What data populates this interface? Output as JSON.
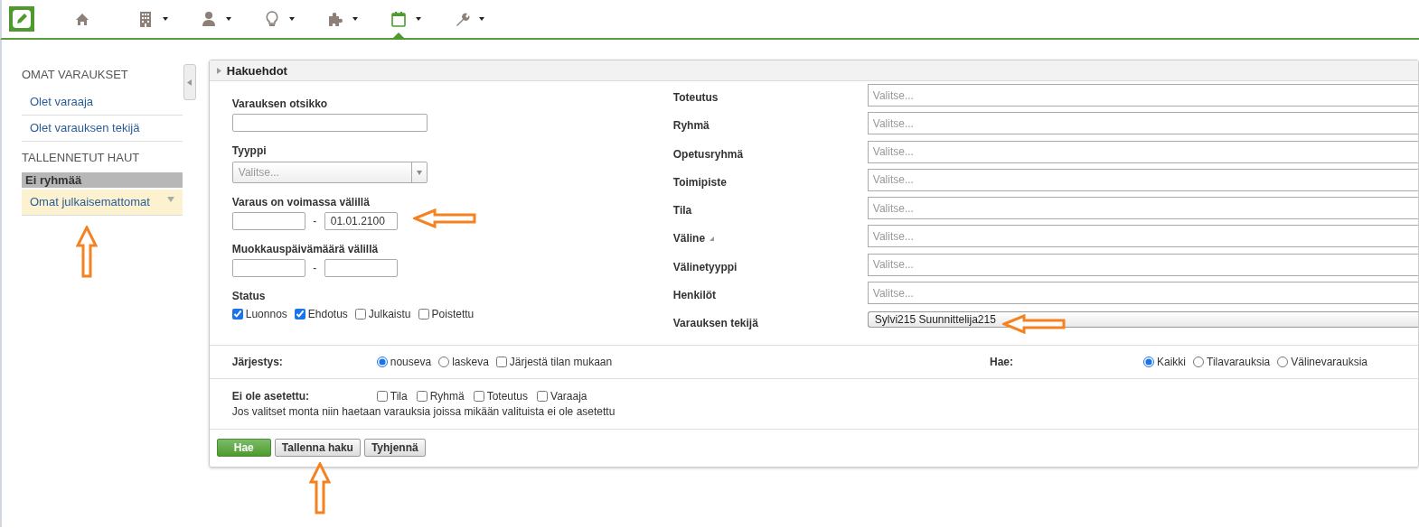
{
  "nav": {
    "items": [
      {
        "kind": "home",
        "dropdown": false,
        "selected": false
      },
      {
        "kind": "building",
        "dropdown": true,
        "selected": false
      },
      {
        "kind": "person",
        "dropdown": true,
        "selected": false
      },
      {
        "kind": "bulb",
        "dropdown": true,
        "selected": false
      },
      {
        "kind": "puzzle",
        "dropdown": true,
        "selected": false
      },
      {
        "kind": "calendar",
        "dropdown": true,
        "selected": true
      },
      {
        "kind": "wrench",
        "dropdown": true,
        "selected": false
      }
    ]
  },
  "sidebar": {
    "sections": [
      {
        "heading": "OMAT VARAUKSET",
        "items": [
          {
            "label": "Olet varaaja",
            "selected": false
          },
          {
            "label": "Olet varauksen tekijä",
            "selected": false
          }
        ]
      },
      {
        "heading": "TALLENNETUT HAUT",
        "group": "Ei ryhmää",
        "items": [
          {
            "label": "Omat julkaisemattomat",
            "selected": true
          }
        ]
      }
    ]
  },
  "panel": {
    "title": "Hakuehdot",
    "title_field": {
      "label": "Varauksen otsikko"
    },
    "type_field": {
      "label": "Tyyppi",
      "placeholder": "Valitse..."
    },
    "valid_range": {
      "label": "Varaus on voimassa välillä",
      "separator": "-",
      "to": "01.01.2100"
    },
    "modified_range": {
      "label": "Muokkauspäivämäärä välillä",
      "separator": "-"
    },
    "status": {
      "label": "Status",
      "options": [
        {
          "label": "Luonnos",
          "checked": true
        },
        {
          "label": "Ehdotus",
          "checked": true
        },
        {
          "label": "Julkaistu",
          "checked": false
        },
        {
          "label": "Poistettu",
          "checked": false
        }
      ]
    },
    "filters": [
      {
        "label": "Toteutus",
        "placeholder": "Valitse...",
        "expandable": false
      },
      {
        "label": "Ryhmä",
        "placeholder": "Valitse...",
        "expandable": false
      },
      {
        "label": "Opetusryhmä",
        "placeholder": "Valitse...",
        "expandable": false
      },
      {
        "label": "Toimipiste",
        "placeholder": "Valitse...",
        "expandable": false
      },
      {
        "label": "Tila",
        "placeholder": "Valitse...",
        "expandable": false
      },
      {
        "label": "Väline",
        "placeholder": "Valitse...",
        "expandable": true
      },
      {
        "label": "Välinetyyppi",
        "placeholder": "Valitse...",
        "expandable": false
      },
      {
        "label": "Henkilöt",
        "placeholder": "Valitse...",
        "expandable": false
      },
      {
        "label": "Varauksen tekijä",
        "value": "Sylvi215 Suunnittelija215",
        "expandable": false
      }
    ],
    "order": {
      "label": "Järjestys:",
      "options": [
        {
          "kind": "radio",
          "label": "nouseva",
          "selected": true
        },
        {
          "kind": "radio",
          "label": "laskeva",
          "selected": false
        },
        {
          "kind": "checkbox",
          "label": "Järjestä tilan mukaan",
          "checked": false
        }
      ]
    },
    "search_scope": {
      "label": "Hae:",
      "options": [
        {
          "label": "Kaikki",
          "selected": true
        },
        {
          "label": "Tilavarauksia",
          "selected": false
        },
        {
          "label": "Välinevarauksia",
          "selected": false
        }
      ]
    },
    "unset": {
      "label": "Ei ole asetettu:",
      "options": [
        {
          "label": "Tila",
          "checked": false
        },
        {
          "label": "Ryhmä",
          "checked": false
        },
        {
          "label": "Toteutus",
          "checked": false
        },
        {
          "label": "Varaaja",
          "checked": false
        }
      ],
      "note": "Jos valitset monta niin haetaan varauksia joissa mikään valituista ei ole asetettu"
    },
    "buttons": [
      {
        "label": "Hae",
        "kind": "primary"
      },
      {
        "label": "Tallenna haku",
        "kind": "secondary"
      },
      {
        "label": "Tyhjennä",
        "kind": "secondary"
      }
    ]
  },
  "annotations": [
    {
      "kind": "up"
    },
    {
      "kind": "left"
    },
    {
      "kind": "left"
    },
    {
      "kind": "up"
    }
  ]
}
